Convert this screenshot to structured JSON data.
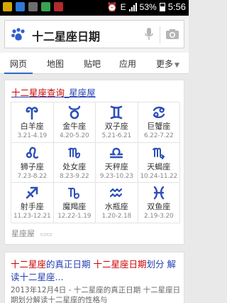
{
  "status_bar": {
    "battery": "53%",
    "time": "5:56",
    "network": "E"
  },
  "search": {
    "query": "十二星座日期",
    "icons": [
      "baidu-paw-icon",
      "microphone-icon",
      "camera-icon"
    ]
  },
  "tabs": [
    {
      "label": "网页",
      "active": true
    },
    {
      "label": "地图"
    },
    {
      "label": "贴吧"
    },
    {
      "label": "应用"
    },
    {
      "label": "更多"
    }
  ],
  "zodiac_card": {
    "title_highlight": "十二星座查询",
    "title_rest": "_星座屋",
    "source": "星座屋",
    "signs": [
      {
        "name": "白羊座",
        "dates": "3.21-4.19",
        "icon": "aries-icon"
      },
      {
        "name": "金牛座",
        "dates": "4.20-5.20",
        "icon": "taurus-icon"
      },
      {
        "name": "双子座",
        "dates": "5.21-6.21",
        "icon": "gemini-icon"
      },
      {
        "name": "巨蟹座",
        "dates": "6.22-7.22",
        "icon": "cancer-icon"
      },
      {
        "name": "狮子座",
        "dates": "7.23-8.22",
        "icon": "leo-icon"
      },
      {
        "name": "处女座",
        "dates": "8.23-9.22",
        "icon": "virgo-icon"
      },
      {
        "name": "天秤座",
        "dates": "9.23-10.23",
        "icon": "libra-icon"
      },
      {
        "name": "天蝎座",
        "dates": "10.24-11.22",
        "icon": "scorpio-icon"
      },
      {
        "name": "射手座",
        "dates": "11.23-12.21",
        "icon": "sagittarius-icon"
      },
      {
        "name": "魔羯座",
        "dates": "12.22-1.19",
        "icon": "capricorn-icon"
      },
      {
        "name": "水瓶座",
        "dates": "1.20-2.18",
        "icon": "aquarius-icon"
      },
      {
        "name": "双鱼座",
        "dates": "2.19-3.20",
        "icon": "pisces-icon"
      }
    ]
  },
  "result2": {
    "title_p1": "十二星座",
    "title_p2": "的真正日期 ",
    "title_p3": "十二星座日期",
    "title_p4": "划分 解读十二星座...",
    "snippet": "2013年12月4日 - 十二星座的真正日期 十二星座日期划分解读十二星座的性格与"
  },
  "colors": {
    "link": "#2440b3",
    "highlight": "#cc0000",
    "symbol": "#2d4fb8",
    "tab_active": "#3366cc"
  }
}
